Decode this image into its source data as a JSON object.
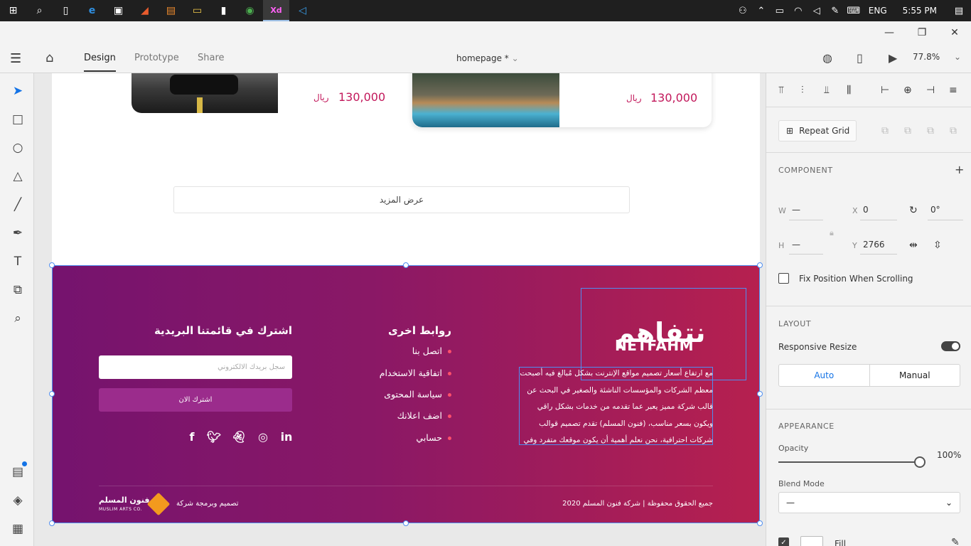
{
  "taskbar": {
    "apps": [
      {
        "name": "start-icon",
        "glyph": "⊞"
      },
      {
        "name": "search-icon",
        "glyph": "⌕"
      },
      {
        "name": "task-view-icon",
        "glyph": "▯"
      },
      {
        "name": "edge-icon",
        "glyph": "e"
      },
      {
        "name": "store-icon",
        "glyph": "▣"
      },
      {
        "name": "media-app-icon",
        "glyph": "◢"
      },
      {
        "name": "html-editor-icon",
        "glyph": "▤"
      },
      {
        "name": "file-explorer-icon",
        "glyph": "▭"
      },
      {
        "name": "terminal-icon",
        "glyph": "▮"
      },
      {
        "name": "chrome-icon",
        "glyph": "◉"
      },
      {
        "name": "adobe-xd-icon",
        "glyph": "Xd"
      },
      {
        "name": "vscode-icon",
        "glyph": "◁"
      }
    ],
    "language": "ENG",
    "time": "5:55 PM"
  },
  "toolbar": {
    "tabs": [
      "Design",
      "Prototype",
      "Share"
    ],
    "doc_name": "homepage *",
    "zoom": "77.8%"
  },
  "canvas": {
    "products": [
      {
        "price": "130,000",
        "currency": "ريال"
      },
      {
        "price": "130,000",
        "currency": "ريال"
      }
    ],
    "more_button": "عرض المزيد",
    "footer": {
      "newsletter_title": "اشترك في قائمتنا البريدية",
      "email_placeholder": "سجل بريدك الالكتروني",
      "subscribe_button": "اشترك الان",
      "links_title": "روابط اخرى",
      "links": [
        "اتصل بنا",
        "اتفاقية الاستخدام",
        "سياسة المحتوى",
        "اضف اعلانك",
        "حسابي"
      ],
      "logo_ar": "نتفاهم",
      "logo_en": "NETFAHM",
      "about": "مع ارتفاع أسعار تصميم مواقع الإنترنت بشكل مُبالغ فيه أصبحت معظم الشركات والمؤسسات الناشئة والصغير في البحث عن قالب شركة مميز يعبر عما تقدمه من خدمات بشكل راقي ويكون بسعر مناسب، (فنون المسلم) تقدم تصميم قوالب شركات احترافية، نحن نعلم أهمية أن يكون موقعك متفرد وفي",
      "copyright": "جميع الحقوق محفوظة | شركة فنون المسلم 2020",
      "design_credit": "تصميم وبرمجة شركة",
      "brand_name": "فنون المسلم",
      "brand_sub": "MUSLIM ARTS CO."
    }
  },
  "panel": {
    "repeat_grid": "Repeat Grid",
    "component_title": "COMPONENT",
    "w_label": "W",
    "w_value": "—",
    "h_label": "H",
    "h_value": "—",
    "x_label": "X",
    "x_value": "0",
    "y_label": "Y",
    "y_value": "2766",
    "rotation": "0°",
    "fix_position": "Fix Position When Scrolling",
    "layout_title": "LAYOUT",
    "responsive_resize": "Responsive Resize",
    "auto": "Auto",
    "manual": "Manual",
    "appearance_title": "APPEARANCE",
    "opacity_label": "Opacity",
    "opacity_value": "100%",
    "blend_label": "Blend Mode",
    "blend_value": "—",
    "fill_label": "Fill"
  }
}
